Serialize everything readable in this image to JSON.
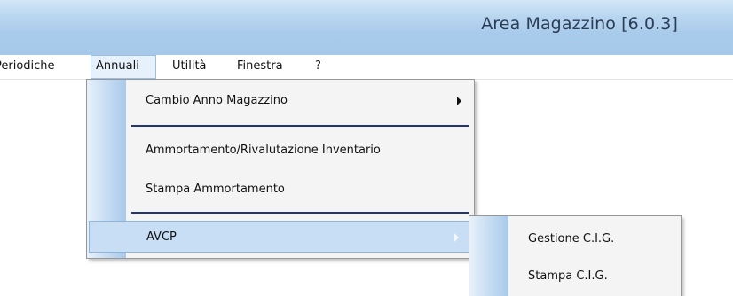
{
  "window": {
    "title": "Area Magazzino [6.0.3]"
  },
  "menubar": {
    "items": [
      {
        "label": "Periodiche"
      },
      {
        "label": "Annuali"
      },
      {
        "label": "Utilità"
      },
      {
        "label": "Finestra"
      },
      {
        "label": "?"
      }
    ]
  },
  "dropdown": {
    "items": [
      {
        "label": "Cambio Anno Magazzino",
        "has_submenu": true
      },
      {
        "label": "Ammortamento/Rivalutazione Inventario"
      },
      {
        "label": "Stampa Ammortamento"
      },
      {
        "label": "AVCP",
        "has_submenu": true,
        "highlighted": true
      }
    ]
  },
  "submenu": {
    "items": [
      {
        "label": "Gestione C.I.G."
      },
      {
        "label": "Stampa C.I.G."
      }
    ]
  },
  "colors": {
    "titlebar": "#a9cbeb",
    "highlight": "#c7def5",
    "separator": "#23357a",
    "menu_background": "#f4f4f4"
  }
}
